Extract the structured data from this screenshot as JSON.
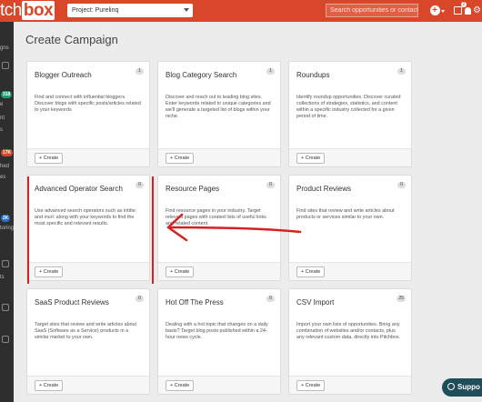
{
  "header": {
    "logo_prefix": "tch",
    "logo_box": "box",
    "project_label": "Project: Purelinq",
    "search_placeholder": "Search opportunities or contacts",
    "add_icon": "+",
    "tasks_badge": "2",
    "bell_icon": "🔔",
    "gear_icon": "⚙"
  },
  "sidebar": {
    "items": [
      {
        "label": "gns"
      },
      {
        "badge": "318",
        "color": "#1e9e73"
      },
      {
        "label": "e"
      },
      {
        "label": "nt"
      },
      {
        "label": "s"
      },
      {
        "badge": "17K",
        "color": "#d9472b"
      },
      {
        "label": "hed"
      },
      {
        "label": "es"
      },
      {
        "badge": "2K",
        "color": "#2a6fc9"
      },
      {
        "label": "toring"
      },
      {
        "label": "ts"
      }
    ]
  },
  "main": {
    "title": "Create Campaign",
    "create_label": "+ Create",
    "cards": [
      {
        "title": "Blogger Outreach",
        "count": "1",
        "desc": "Find and connect with influential bloggers. Discover blogs with specific posts/articles related to your keywords"
      },
      {
        "title": "Blog Category Search",
        "count": "1",
        "desc": "Discover and reach out to leading blog sites. Enter keywords related to unique categories and we'll generate a targeted list of blogs within your niche."
      },
      {
        "title": "Roundups",
        "count": "1",
        "desc": "Identify roundup opportunities. Discover curated collections of strategies, statistics, and content within a specific industry collected for a given period of time."
      },
      {
        "title": "Advanced Operator Search",
        "count": "0",
        "desc": "Use advanced search operators such as intitle: and inurl: along with your keywords to find the most specific and relevant results."
      },
      {
        "title": "Resource Pages",
        "count": "0",
        "desc": "Find resource pages in your industry. Target relevant pages with curated lists of useful links and related content."
      },
      {
        "title": "Product Reviews",
        "count": "0",
        "desc": "Find sites that review and write articles about products or services similar to your own."
      },
      {
        "title": "SaaS Product Reviews",
        "count": "0",
        "desc": "Target sites that review and write articles about SaaS (Software as a Service) products in a similar market to your own."
      },
      {
        "title": "Hot Off The Press",
        "count": "0",
        "desc": "Dealing with a hot topic that changes on a daily basis? Target blog posts published within a 24-hour news cycle."
      },
      {
        "title": "CSV Import",
        "count": "25",
        "desc": "Import your own lists of opportunities. Bring any combination of websites and/or contacts, plus any relevant custom data, directly into Pitchbox."
      }
    ]
  },
  "chat": {
    "label": "Suppo"
  },
  "colors": {
    "brand": "#d9472b",
    "annotation": "#d42121",
    "chat": "#1f4d5a"
  }
}
